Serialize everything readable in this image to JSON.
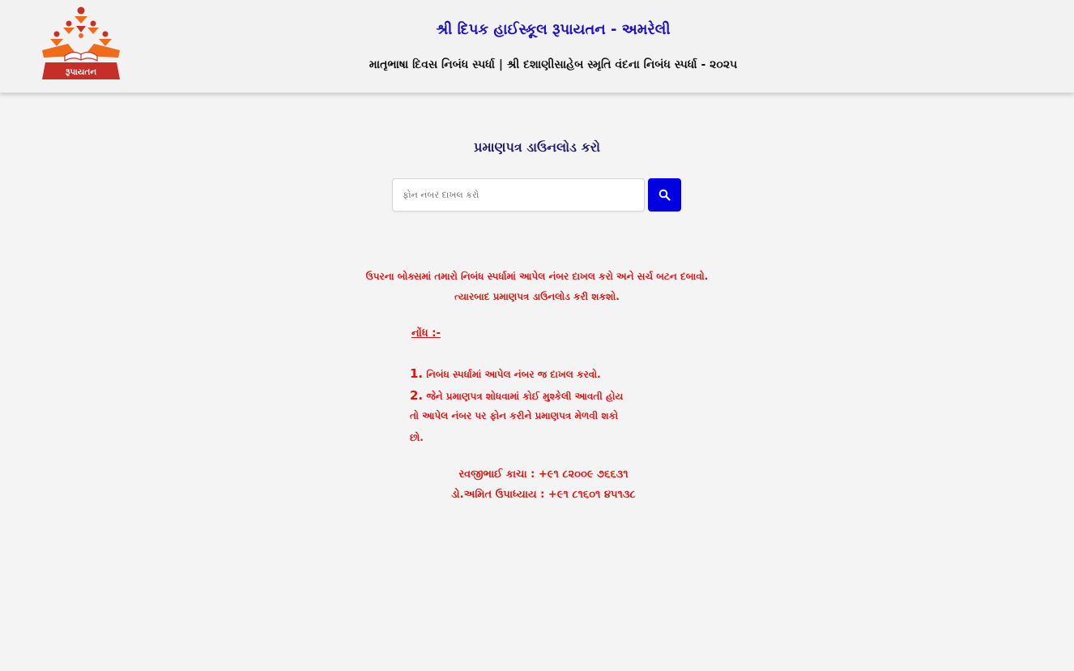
{
  "header": {
    "logo_text": "રૂપાયતન",
    "school_title": "શ્રી દિપક હાઈસ્કૂલ રૂપાયતન - અમરેલી",
    "contest_title": "માતૃભાષા દિવસ નિબંધ સ્પર્ધા | શ્રી દશાણીસાહેબ સ્મૃતિ વંદના નિબંધ સ્પર્ધા - ૨૦૨૫"
  },
  "main": {
    "heading": "પ્રમાણપત્ર ડાઉનલોડ કરો",
    "search": {
      "placeholder": "ફોન નંબર દાખલ કરો",
      "value": "",
      "button_icon": "search-icon"
    },
    "instructions": [
      "ઉપરના બોક્સમાં તમારો નિબંધ સ્પર્ધામાં આપેલ નંબર દાખલ કરો અને સર્ચ બટન દબાવો.",
      "ત્યારબાદ પ્રમાણપત્ર ડાઉનલોડ કરી શકશો."
    ],
    "note": {
      "heading": "નોંધ :-",
      "items": [
        {
          "num": "1.",
          "text": "નિબંધ સ્પર્ધામાં આપેલ નંબર જ દાખલ કરવો."
        },
        {
          "num": "2.",
          "text": "જેને પ્રમાણપત્ર શોધવામાં કોઈ મુશ્કેલી આવતી હોય"
        }
      ],
      "continuation": [
        "તો આપેલ નંબર પર ફોન કરીને પ્રમાણપત્ર મેળવી શકો",
        "છો."
      ]
    },
    "contacts": [
      "રવજીભાઈ કાચા : +૯૧ ૮૨૦૦૯ ૭૬૬૩૧",
      "ડો.અમિત ઉપાધ્યાય : +૯૧ ૮૧૬૦૧ ૪૫૧૩૮"
    ]
  },
  "colors": {
    "title_blue": "#1a10c8",
    "heading_navy": "#1b1a6e",
    "text_red": "#e2120e",
    "button_blue": "#0000e0",
    "logo_orange": "#f26a1b",
    "logo_red": "#c62e2a"
  }
}
